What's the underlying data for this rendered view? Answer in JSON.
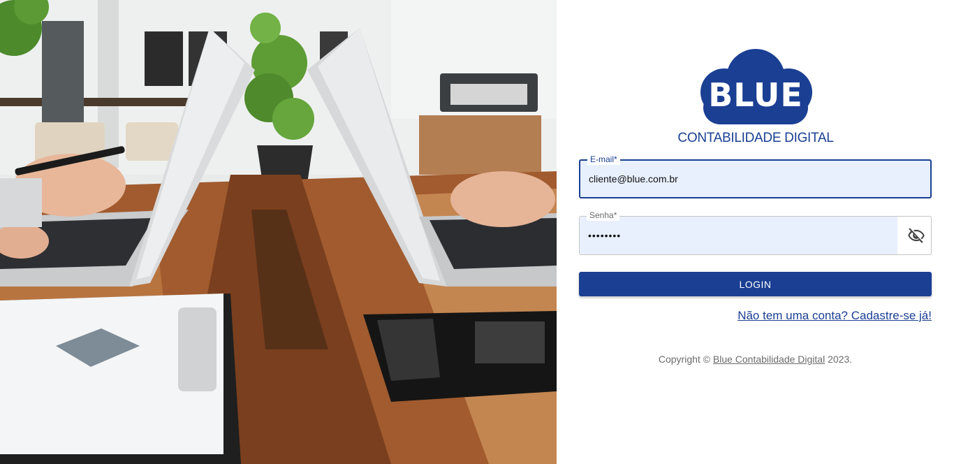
{
  "brand": {
    "logo_word": "BLUE",
    "tagline": "CONTABILIDADE DIGITAL",
    "primary_color": "#1a3f93"
  },
  "form": {
    "email": {
      "label": "E-mail*",
      "value": "cliente@blue.com.br"
    },
    "password": {
      "label": "Senha*",
      "value": "••••••••",
      "toggle_icon": "eye-off-icon"
    },
    "login_label": "LOGIN",
    "signup_link": "Não tem uma conta? Cadastre-se já!"
  },
  "footer": {
    "prefix": "Copyright ©",
    "company_link": "Blue Contabilidade Digital",
    "suffix": "2023."
  },
  "photo": {
    "subject": "two people working on laptops at a wooden table"
  }
}
